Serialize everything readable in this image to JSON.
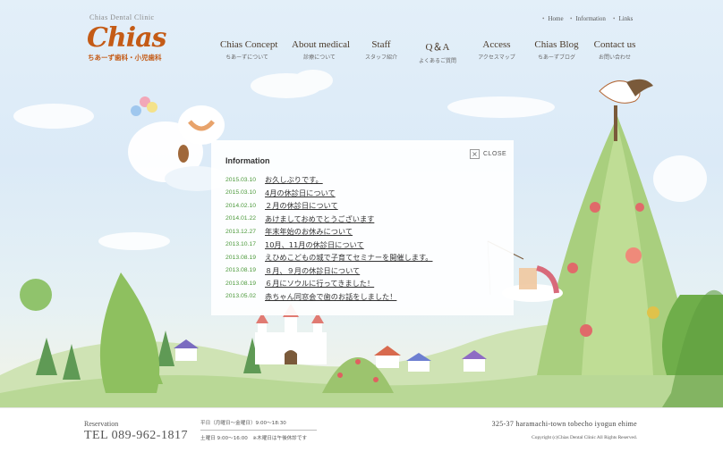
{
  "header": {
    "clinic_name": "Chias Dental Clinic",
    "logo_text": "Chias",
    "logo_sub": "ちあーず歯科・小児歯科"
  },
  "utility_nav": [
    {
      "label": "Home"
    },
    {
      "label": "Information"
    },
    {
      "label": "Links"
    }
  ],
  "main_nav": [
    {
      "en": "Chias Concept",
      "jp": "ちあーずについて"
    },
    {
      "en": "About medical",
      "jp": "診療について"
    },
    {
      "en": "Staff",
      "jp": "スタッフ紹介"
    },
    {
      "en": "Q＆A",
      "jp": "よくあるご質問"
    },
    {
      "en": "Access",
      "jp": "アクセスマップ"
    },
    {
      "en": "Chias Blog",
      "jp": "ちあーずブログ"
    },
    {
      "en": "Contact us",
      "jp": "お問い合わせ"
    }
  ],
  "info_panel": {
    "title": "Information",
    "close_label": "CLOSE",
    "items": [
      {
        "date": "2015.03.10",
        "title": "お久しぶりです。"
      },
      {
        "date": "2015.03.10",
        "title": "4月の休診日について"
      },
      {
        "date": "2014.02.10",
        "title": "２月の休診日について"
      },
      {
        "date": "2014.01.22",
        "title": "あけましておめでとうございます"
      },
      {
        "date": "2013.12.27",
        "title": "年末年始のお休みについて"
      },
      {
        "date": "2013.10.17",
        "title": "10月、11月の休診日について"
      },
      {
        "date": "2013.08.19",
        "title": "えひめこどもの城で子育てセミナーを開催します。"
      },
      {
        "date": "2013.08.19",
        "title": "８月、９月の休診日について"
      },
      {
        "date": "2013.08.19",
        "title": "６月にソウルに行ってきました！"
      },
      {
        "date": "2013.05.02",
        "title": "赤ちゃん同窓会で歯のお話をしました！"
      }
    ]
  },
  "footer": {
    "reservation_label": "Reservation",
    "tel": "TEL 089-962-1817",
    "hours_weekday": "平日（月曜日～金曜日）9:00～18:30",
    "hours_weekend": "土曜日 9:00～16:00　※木曜日は午後休診です",
    "address": "325-37 haramachi-town tobecho iyogun ehime",
    "copyright": "Copyright (c)Chias Dental Clinic All Rights Reserved."
  },
  "colors": {
    "logo": "#c45b16",
    "date": "#4d9a3c",
    "sky": "#dbeaf7"
  },
  "icons": [
    "close-icon"
  ]
}
